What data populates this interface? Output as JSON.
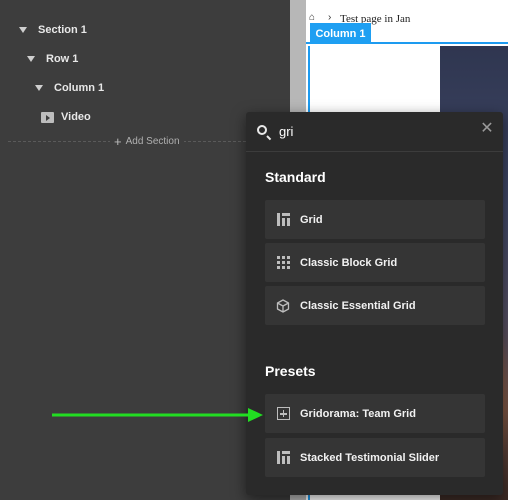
{
  "navigator": {
    "items": [
      {
        "label": "Section 1",
        "type": "section"
      },
      {
        "label": "Row 1",
        "type": "row"
      },
      {
        "label": "Column 1",
        "type": "column"
      },
      {
        "label": "Video",
        "type": "video"
      }
    ],
    "add_section_label": "Add Section"
  },
  "canvas": {
    "page_title": "Test page in Jan",
    "column_badge": "Column 1"
  },
  "element_search": {
    "query": "gri",
    "placeholder": "",
    "groups": [
      {
        "heading": "Standard",
        "items": [
          {
            "label": "Grid",
            "icon": "grid-icon"
          },
          {
            "label": "Classic Block Grid",
            "icon": "block-grid-icon"
          },
          {
            "label": "Classic Essential Grid",
            "icon": "cube-icon"
          }
        ]
      },
      {
        "heading": "Presets",
        "items": [
          {
            "label": "Gridorama: Team Grid",
            "icon": "plus-square-icon"
          },
          {
            "label": "Stacked Testimonial Slider",
            "icon": "grid-icon"
          }
        ]
      }
    ]
  },
  "colors": {
    "accent": "#1e9ff2",
    "arrow": "#22dd22",
    "popover_bg": "#2a2a2a",
    "panel_bg": "#3d3d3d"
  }
}
